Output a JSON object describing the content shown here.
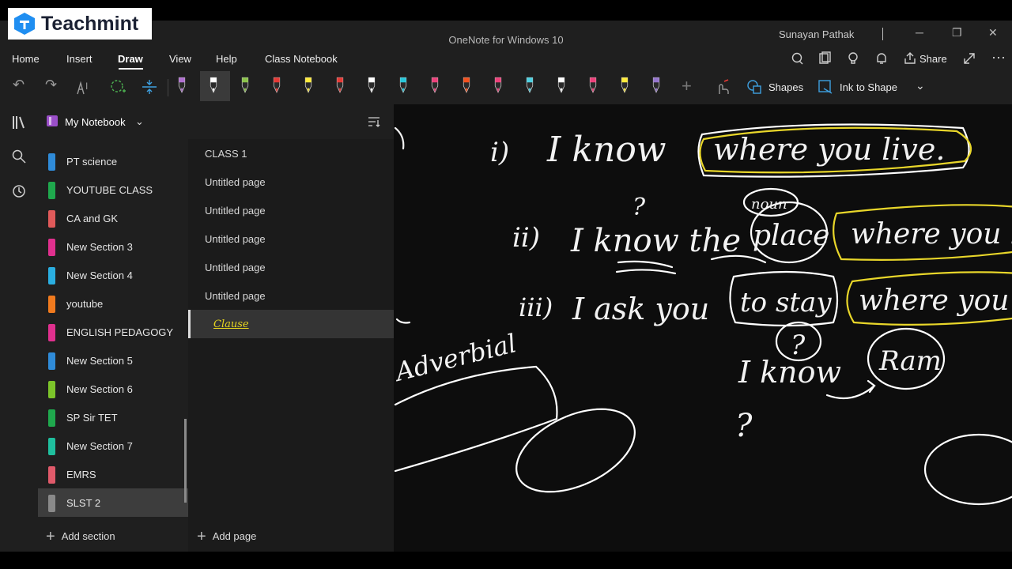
{
  "brand": {
    "name": "Teachmint"
  },
  "window": {
    "title": "OneNote for Windows 10",
    "user": "Sunayan Pathak"
  },
  "menu": [
    "Home",
    "Insert",
    "Draw",
    "View",
    "Help",
    "Class Notebook"
  ],
  "menu_active": "Draw",
  "ribbon": {
    "share_label": "Share"
  },
  "toolbar": {
    "shapes_label": "Shapes",
    "ink_to_shape_label": "Ink to Shape",
    "pen_colors": [
      "#b070d0",
      "#ffffff",
      "#8bc34a",
      "#e53935",
      "#ffeb3b",
      "#e53935",
      "#ffffff",
      "#26c6da",
      "#ec407a",
      "#f4511e",
      "#ec407a",
      "#4dd0e1",
      "#ffffff",
      "#ec407a",
      "#ffeb3b",
      "#9575cd"
    ]
  },
  "notebook": {
    "title": "My Notebook",
    "sections": [
      {
        "label": "PT science",
        "color": "#2f8bd8"
      },
      {
        "label": "YOUTUBE CLASS",
        "color": "#1fa84d"
      },
      {
        "label": "CA and GK",
        "color": "#e05a5a"
      },
      {
        "label": "New Section 3",
        "color": "#e0308e"
      },
      {
        "label": "New Section 4",
        "color": "#2aaee0"
      },
      {
        "label": "youtube",
        "color": "#f07a1e"
      },
      {
        "label": "ENGLISH PEDAGOGY",
        "color": "#e0308e"
      },
      {
        "label": "New Section 5",
        "color": "#2f8bd8"
      },
      {
        "label": "New Section 6",
        "color": "#7cc42a"
      },
      {
        "label": "SP Sir TET",
        "color": "#1fa84d"
      },
      {
        "label": "New Section 7",
        "color": "#1fbf9e"
      },
      {
        "label": "EMRS",
        "color": "#e05a6a"
      },
      {
        "label": "SLST 2",
        "color": "#8a8a8a"
      }
    ],
    "selected_section": "SLST 2",
    "add_section_label": "Add section"
  },
  "pages": {
    "items": [
      "CLASS 1",
      "Untitled page",
      "Untitled page",
      "Untitled page",
      "Untitled page",
      "Untitled page",
      "Clause"
    ],
    "selected": "Clause",
    "add_page_label": "Add page"
  },
  "canvas": {
    "line1": {
      "number": "i)",
      "main": "I know",
      "clause": "where you live."
    },
    "line2": {
      "number": "ii)",
      "main": "I know the",
      "noun": "place",
      "tag": "noun",
      "clause": "where you live"
    },
    "line3": {
      "number": "iii)",
      "main": "I ask you",
      "verb": "to stay",
      "clause": "where you live"
    },
    "adverbial": "Adverbial",
    "q_mark": "?",
    "line4": {
      "main": "I know",
      "name": "Ram"
    }
  }
}
